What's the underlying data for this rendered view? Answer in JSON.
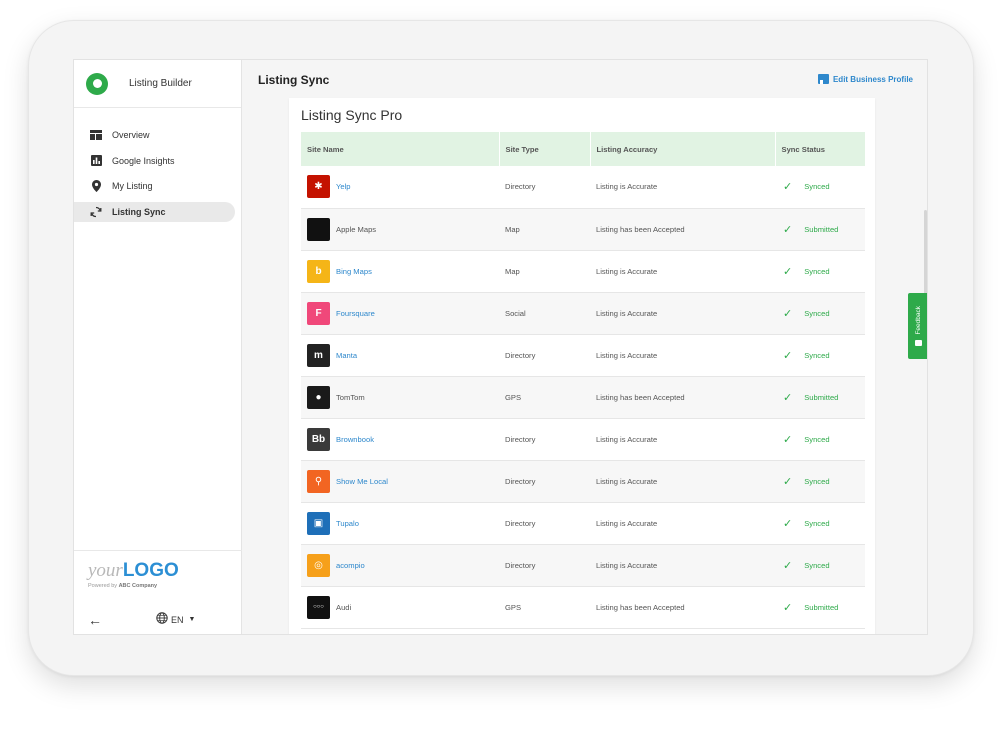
{
  "brand": {
    "name": "Listing Builder",
    "accent": "#2eaa4a"
  },
  "sidebar": {
    "items": [
      {
        "label": "Overview",
        "icon": "dashboard-icon",
        "active": false
      },
      {
        "label": "Google Insights",
        "icon": "bar-chart-icon",
        "active": false
      },
      {
        "label": "My Listing",
        "icon": "location-pin-icon",
        "active": false
      },
      {
        "label": "Listing Sync",
        "icon": "sync-icon",
        "active": true
      }
    ],
    "logo": {
      "your": "your",
      "main": "LOGO",
      "powered_prefix": "Powered by",
      "powered_company": "ABC Company"
    },
    "language": "EN"
  },
  "header": {
    "title": "Listing Sync",
    "edit_label": "Edit Business Profile"
  },
  "card": {
    "title": "Listing Sync Pro"
  },
  "table": {
    "columns": [
      "Site Name",
      "Site Type",
      "Listing Accuracy",
      "Sync Status"
    ],
    "rows": [
      {
        "name": "Yelp",
        "type": "Directory",
        "accuracy": "Listing is Accurate",
        "status": "Synced",
        "icon": "yelp-icon",
        "glyph": "✱",
        "color": "#c41200",
        "link": true
      },
      {
        "name": "Apple Maps",
        "type": "Map",
        "accuracy": "Listing has been Accepted",
        "status": "Submitted",
        "icon": "apple-icon",
        "glyph": "",
        "color": "#111111",
        "link": false
      },
      {
        "name": "Bing Maps",
        "type": "Map",
        "accuracy": "Listing is Accurate",
        "status": "Synced",
        "icon": "bing-icon",
        "glyph": "b",
        "color": "#f5b517",
        "link": true
      },
      {
        "name": "Foursquare",
        "type": "Social",
        "accuracy": "Listing is Accurate",
        "status": "Synced",
        "icon": "foursquare-icon",
        "glyph": "F",
        "color": "#f0487a",
        "link": true
      },
      {
        "name": "Manta",
        "type": "Directory",
        "accuracy": "Listing is Accurate",
        "status": "Synced",
        "icon": "manta-icon",
        "glyph": "m",
        "color": "#222222",
        "link": true
      },
      {
        "name": "TomTom",
        "type": "GPS",
        "accuracy": "Listing has been Accepted",
        "status": "Submitted",
        "icon": "tomtom-icon",
        "glyph": "●",
        "color": "#1a1a1a",
        "link": false
      },
      {
        "name": "Brownbook",
        "type": "Directory",
        "accuracy": "Listing is Accurate",
        "status": "Synced",
        "icon": "brownbook-icon",
        "glyph": "Bb",
        "color": "#3a3a3a",
        "link": true
      },
      {
        "name": "Show Me Local",
        "type": "Directory",
        "accuracy": "Listing is Accurate",
        "status": "Synced",
        "icon": "showmelocal-icon",
        "glyph": "⚲",
        "color": "#f26522",
        "link": true
      },
      {
        "name": "Tupalo",
        "type": "Directory",
        "accuracy": "Listing is Accurate",
        "status": "Synced",
        "icon": "tupalo-icon",
        "glyph": "▣",
        "color": "#1e6fb8",
        "link": true
      },
      {
        "name": "acompio",
        "type": "Directory",
        "accuracy": "Listing is Accurate",
        "status": "Synced",
        "icon": "acompio-icon",
        "glyph": "◎",
        "color": "#f6a01a",
        "link": true
      },
      {
        "name": "Audi",
        "type": "GPS",
        "accuracy": "Listing has been Accepted",
        "status": "Submitted",
        "icon": "audi-icon",
        "glyph": "○○○",
        "color": "#111111",
        "link": false
      }
    ]
  },
  "feedback": {
    "label": "Feedback"
  }
}
